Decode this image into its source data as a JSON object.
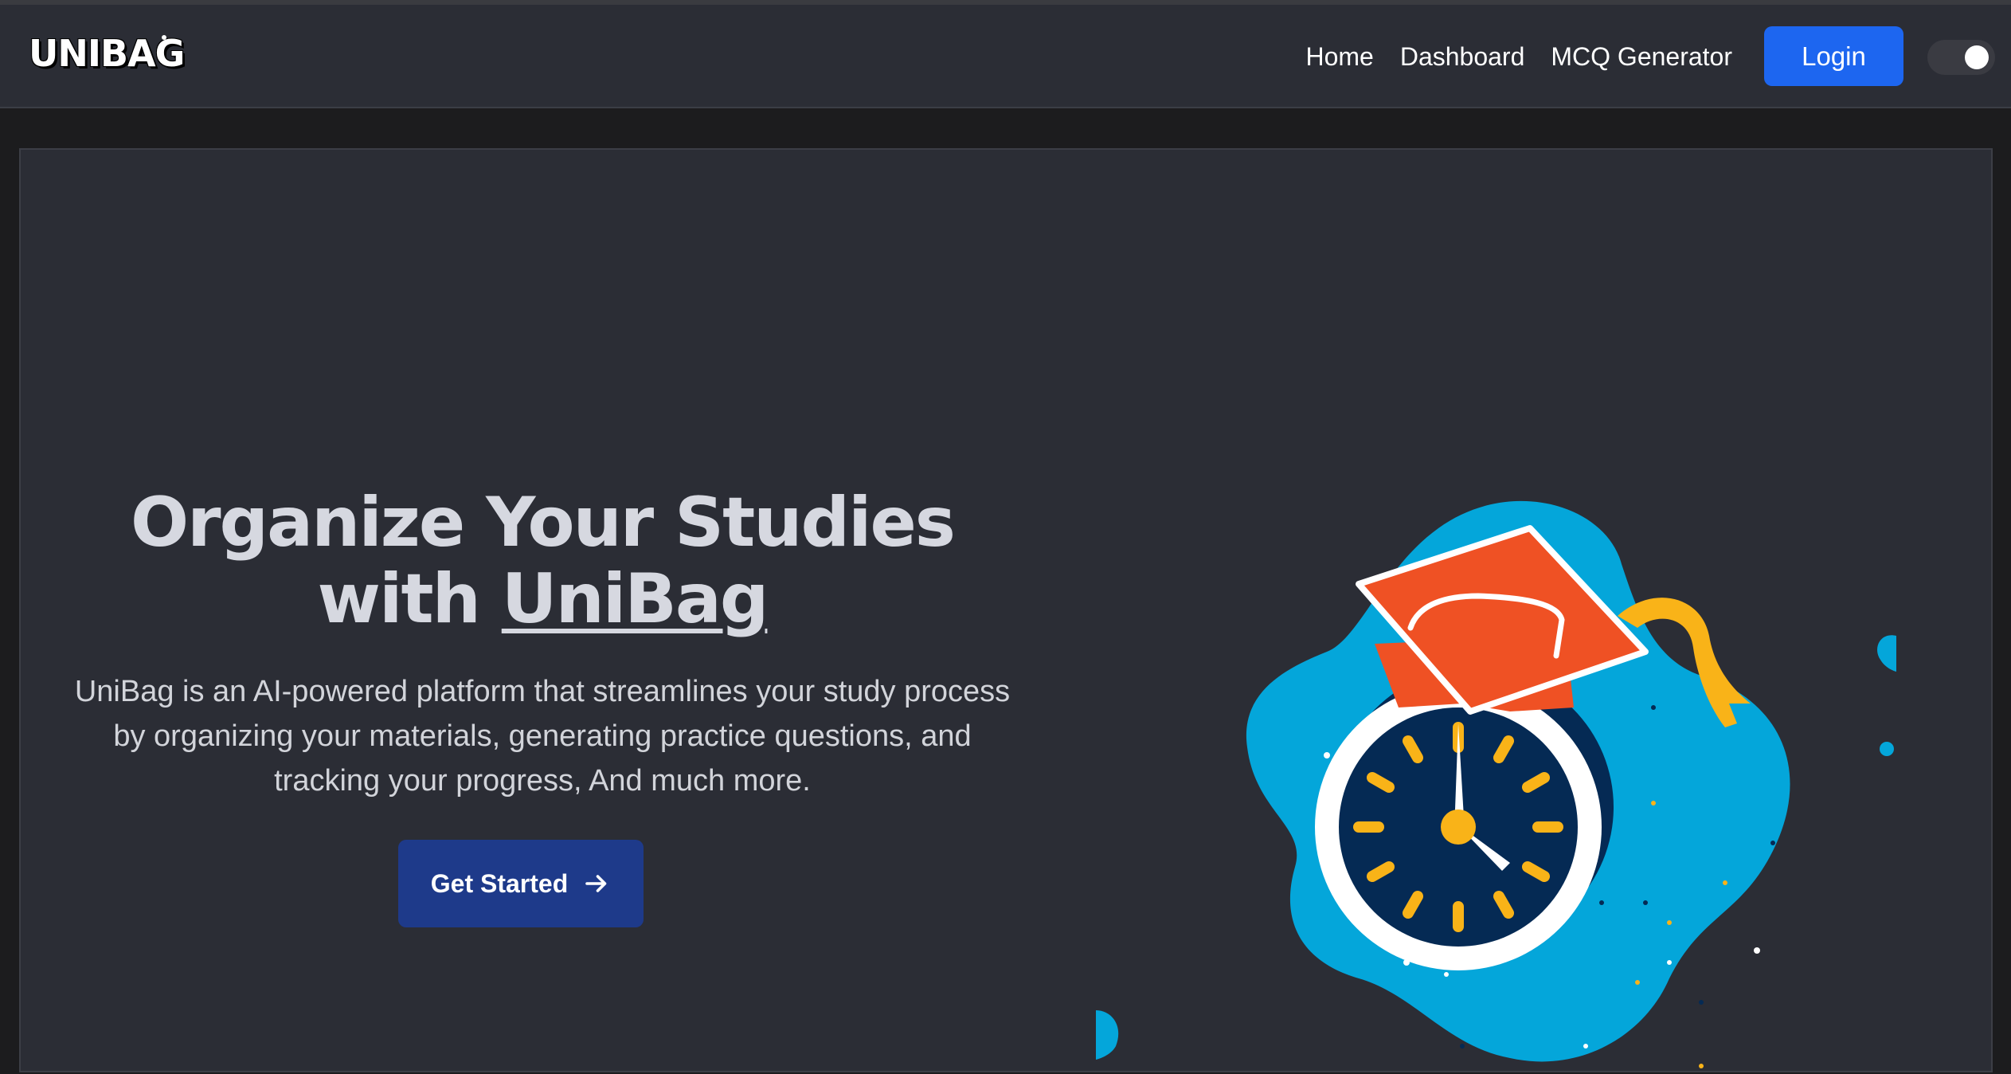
{
  "header": {
    "logo": "UNIBAG",
    "nav": [
      {
        "label": "Home"
      },
      {
        "label": "Dashboard"
      },
      {
        "label": "MCQ Generator"
      }
    ],
    "login_label": "Login"
  },
  "hero": {
    "title_line1": "Organize Your Studies",
    "title_with": "with ",
    "title_brand": "UniBag",
    "description": "UniBag is an AI-powered platform that streamlines your study process by organizing your materials, generating practice questions, and tracking your progress, And much more.",
    "cta_label": "Get Started",
    "illustration_icon": "graduation-cap-clock-illustration"
  },
  "colors": {
    "navbar_bg": "#2b2d35",
    "login_blue": "#1d66f0",
    "cta_blue": "#1e3a8a",
    "blob_blue": "#04a6da",
    "cap_orange": "#ef5124",
    "tassel_yellow": "#f9b318",
    "clock_face": "#052a54"
  }
}
